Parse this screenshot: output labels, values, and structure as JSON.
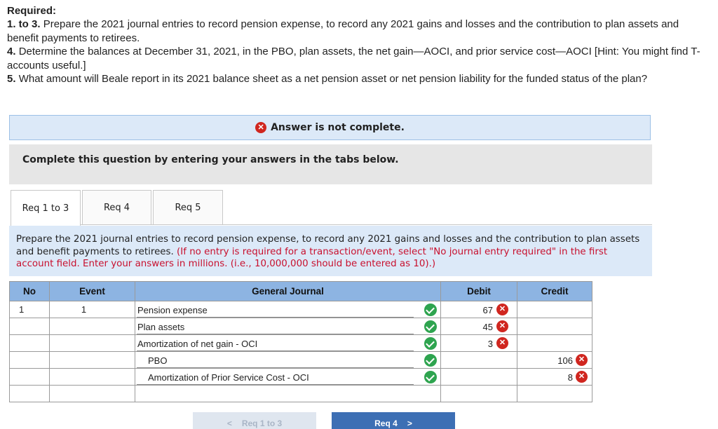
{
  "required": {
    "heading": "Required:",
    "item1_num": "1. to 3.",
    "item1_text": "Prepare the 2021 journal entries to record pension expense, to record any 2021 gains and losses and the contribution to plan assets and benefit payments to retirees.",
    "item4_num": "4.",
    "item4_text": "Determine the balances at December 31, 2021, in the PBO, plan assets, the net gain—AOCI, and prior service cost—AOCI [Hint: You might find T-accounts useful.]",
    "item5_num": "5.",
    "item5_text": "What amount will Beale report in its 2021 balance sheet as a net pension asset or net pension liability for the funded status of the plan?"
  },
  "banner": {
    "text": "Answer is not complete.",
    "icon": "x-circle-icon",
    "icon_color": "#d0261f"
  },
  "instructions": "Complete this question by entering your answers in the tabs below.",
  "tabs": [
    {
      "label": "Req 1 to 3",
      "active": true
    },
    {
      "label": "Req 4",
      "active": false
    },
    {
      "label": "Req 5",
      "active": false
    }
  ],
  "prompt": {
    "text": "Prepare the 2021 journal entries to record pension expense, to record any 2021 gains and losses and the contribution to plan assets and benefit payments to retirees.",
    "note": "(If no entry is required for a transaction/event, select \"No journal entry required\" in the first account field. Enter your answers in millions. (i.e., 10,000,000 should be entered as 10).)"
  },
  "journal": {
    "headers": {
      "no": "No",
      "event": "Event",
      "account": "General Journal",
      "debit": "Debit",
      "credit": "Credit"
    },
    "header_color": "#8db4e2",
    "rows": [
      {
        "no": "1",
        "event": "1",
        "account": "Pension expense",
        "indent": false,
        "debit": "67",
        "credit": "",
        "account_status": "correct",
        "debit_status": "incorrect",
        "credit_status": ""
      },
      {
        "no": "",
        "event": "",
        "account": "Plan assets",
        "indent": false,
        "debit": "45",
        "credit": "",
        "account_status": "correct",
        "debit_status": "incorrect",
        "credit_status": ""
      },
      {
        "no": "",
        "event": "",
        "account": "Amortization of net gain - OCI",
        "indent": false,
        "debit": "3",
        "credit": "",
        "account_status": "correct",
        "debit_status": "incorrect",
        "credit_status": ""
      },
      {
        "no": "",
        "event": "",
        "account": "PBO",
        "indent": true,
        "debit": "",
        "credit": "106",
        "account_status": "correct",
        "debit_status": "",
        "credit_status": "incorrect"
      },
      {
        "no": "",
        "event": "",
        "account": "Amortization of Prior Service Cost - OCI",
        "indent": true,
        "debit": "",
        "credit": "8",
        "account_status": "correct",
        "debit_status": "",
        "credit_status": "incorrect"
      },
      {
        "no": "",
        "event": "",
        "account": "",
        "indent": false,
        "debit": "",
        "credit": "",
        "account_status": "",
        "debit_status": "",
        "credit_status": ""
      }
    ],
    "correct_color": "#2ea44f",
    "incorrect_color": "#d0261f"
  },
  "nav": {
    "prev_label": "Req 1 to 3",
    "next_label": "Req 4",
    "prev_icon": "chevron-left-icon",
    "next_icon": "chevron-right-icon"
  }
}
